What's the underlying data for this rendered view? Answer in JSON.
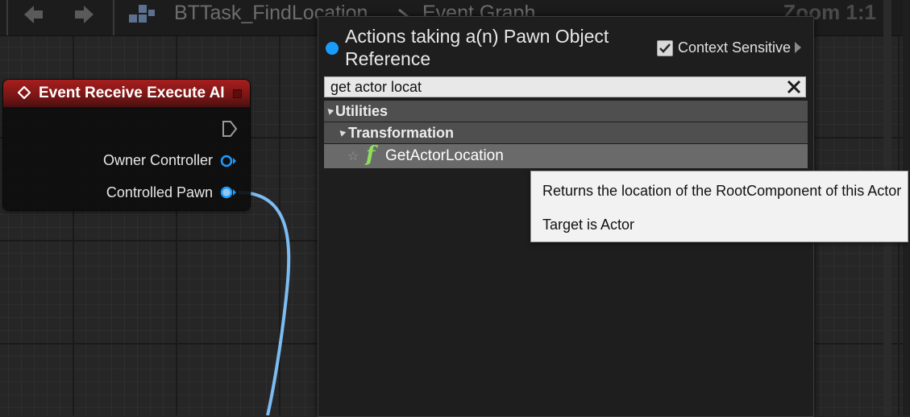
{
  "breadcrumb": {
    "blueprint": "BTTask_FindLocation",
    "graph": "Event Graph",
    "zoom": "Zoom 1:1"
  },
  "node": {
    "title": "Event Receive Execute AI",
    "pins": [
      {
        "label": "Owner Controller"
      },
      {
        "label": "Controlled Pawn"
      }
    ],
    "colors": {
      "header": "#a61e1e",
      "pin": "#1a9cff",
      "wire": "#6fb6f0"
    }
  },
  "menu": {
    "title": "Actions taking a(n) Pawn Object Reference",
    "context_sensitive_label": "Context Sensitive",
    "context_sensitive_checked": true,
    "search_value": "get actor locat",
    "categories": [
      {
        "label": "Utilities"
      },
      {
        "label": "Transformation"
      }
    ],
    "result": {
      "label": "GetActorLocation",
      "icon": "function-icon"
    }
  },
  "tooltip": {
    "description": "Returns the location of the RootComponent of this Actor",
    "target": "Target is Actor"
  }
}
